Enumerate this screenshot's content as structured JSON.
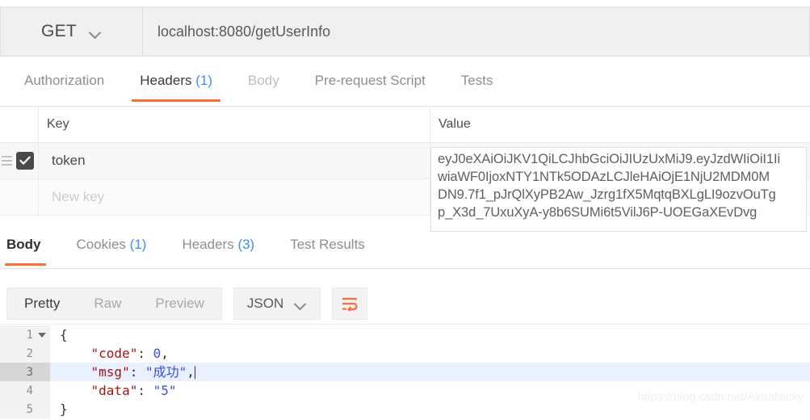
{
  "request": {
    "method": "GET",
    "method_caret_icon": "chevron-down-icon",
    "url": "localhost:8080/getUserInfo",
    "tabs": [
      {
        "label": "Authorization",
        "count": "",
        "state": "normal"
      },
      {
        "label": "Headers",
        "count": "(1)",
        "state": "active"
      },
      {
        "label": "Body",
        "count": "",
        "state": "muted"
      },
      {
        "label": "Pre-request Script",
        "count": "",
        "state": "normal"
      },
      {
        "label": "Tests",
        "count": "",
        "state": "normal"
      }
    ]
  },
  "headers_table": {
    "columns": {
      "key": "Key",
      "value": "Value"
    },
    "rows": [
      {
        "enabled": true,
        "drag_handle_icon": "drag-handle-icon",
        "checkbox_icon": "checkmark-icon",
        "key": "token",
        "value": ""
      },
      {
        "enabled": false,
        "key_placeholder": "New key",
        "value_placeholder": ""
      }
    ]
  },
  "value_popup": {
    "lines": [
      "eyJ0eXAiOiJKV1QiLCJhbGciOiJIUzUxMiJ9.eyJzdWIiOiI1Ii",
      "wiaWF0IjoxNTY1NTk5ODAzLCJleHAiOjE1NjU2MDM0M",
      "DN9.7f1_pJrQlXyPB2Aw_Jzrg1fX5MqtqBXLgLI9ozvOuTg",
      "p_X3d_7UxuXyA-y8b6SUMi6t5VilJ6P-UOEGaXEvDvg"
    ],
    "full_value": "eyJ0eXAiOiJKV1QiLCJhbGciOiJIUzUxMiJ9.eyJzdWIiOiI1IiwiaWF0IjoxNTY1NTk5ODAzLCJleHAiOjE1NjU2MDM0MDN9.7f1_pJrQlXyPB2Aw_Jzrg1fX5MqtqBXLgLI9ozvOuTgp_X3d_7UxuXyA-y8b6SUMi6t5VilJ6P-UOEGaXEvDvg"
  },
  "response": {
    "tabs": [
      {
        "label": "Body",
        "count": "",
        "state": "active"
      },
      {
        "label": "Cookies",
        "count": "(1)",
        "state": "normal"
      },
      {
        "label": "Headers",
        "count": "(3)",
        "state": "normal"
      },
      {
        "label": "Test Results",
        "count": "",
        "state": "normal"
      }
    ],
    "format_modes": [
      {
        "label": "Pretty",
        "state": "active"
      },
      {
        "label": "Raw",
        "state": "normal"
      },
      {
        "label": "Preview",
        "state": "normal"
      }
    ],
    "content_type": "JSON",
    "content_type_caret_icon": "chevron-down-icon",
    "wrap_button_icon": "word-wrap-icon",
    "code_lines": [
      {
        "num": "1",
        "fold": true,
        "highlighted": false,
        "tokens": [
          {
            "t": "punc",
            "v": "{"
          }
        ]
      },
      {
        "num": "2",
        "fold": false,
        "highlighted": false,
        "tokens": [
          {
            "t": "punc",
            "v": "    "
          },
          {
            "t": "key",
            "v": "\"code\""
          },
          {
            "t": "punc",
            "v": ": "
          },
          {
            "t": "num",
            "v": "0"
          },
          {
            "t": "punc",
            "v": ","
          }
        ]
      },
      {
        "num": "3",
        "fold": false,
        "highlighted": true,
        "tokens": [
          {
            "t": "punc",
            "v": "    "
          },
          {
            "t": "key",
            "v": "\"msg\""
          },
          {
            "t": "punc",
            "v": ": "
          },
          {
            "t": "str",
            "v": "\"成功\""
          },
          {
            "t": "punc",
            "v": ","
          }
        ]
      },
      {
        "num": "4",
        "fold": false,
        "highlighted": false,
        "tokens": [
          {
            "t": "punc",
            "v": "    "
          },
          {
            "t": "key",
            "v": "\"data\""
          },
          {
            "t": "punc",
            "v": ": "
          },
          {
            "t": "str",
            "v": "\"5\""
          }
        ]
      },
      {
        "num": "5",
        "fold": false,
        "highlighted": false,
        "tokens": [
          {
            "t": "punc",
            "v": "}"
          }
        ]
      }
    ],
    "json_payload": {
      "code": 0,
      "msg": "成功",
      "data": "5"
    }
  },
  "watermark": {
    "text": "https://blog.csdn.net/AkiraNicky"
  },
  "colors": {
    "accent_orange": "#ff6c37",
    "count_blue": "#3e8bff",
    "json_key": "#a31515",
    "json_string": "#3b4fd8",
    "highlight_row": "#e8f0fe"
  }
}
